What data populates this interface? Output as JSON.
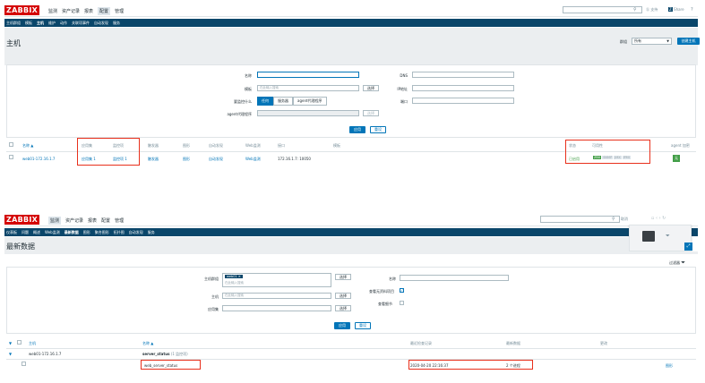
{
  "top": {
    "logo": "ZABBIX",
    "menu": [
      "监测",
      "资产记录",
      "报表",
      "配置",
      "管理"
    ],
    "active_menu": "配置",
    "sub_menu": [
      "主机群组",
      "模板",
      "主机",
      "维护",
      "动作",
      "关联项事件",
      "自动发现",
      "服务"
    ],
    "active_sub": "主机",
    "help_label": "支持",
    "share_label": "Share",
    "question": "?",
    "page_title": "主机",
    "group_label": "群组",
    "group_value": "所有",
    "create_button": "创建主机",
    "filter": {
      "name_label": "名称",
      "dns_label": "DNS",
      "template_label": "模板",
      "template_placeholder": "在此输入搜索",
      "select_label": "选择",
      "ip_label": "IP地址",
      "monitored_by_label": "要监控什么",
      "monitored_options": [
        "任何",
        "服务器",
        "agent代理程序"
      ],
      "port_label": "端口",
      "proxy_label": "agent代理程序",
      "proxy_select": "选择",
      "apply": "应用",
      "reset": "重设"
    },
    "table": {
      "headers": [
        "名称 ▲",
        "应用集",
        "监控项",
        "触发器",
        "图形",
        "自动发现",
        "Web监测",
        "接口",
        "模板",
        "状态",
        "可用性",
        "agent 加密"
      ],
      "row": {
        "name": "web01-172.16.1.7",
        "applications": "应用集 1",
        "items": "监控项 1",
        "triggers": "触发器",
        "graphs": "图形",
        "discovery": "自动发现",
        "web": "Web监测",
        "interface": "172.16.1.7: 10050",
        "status": "已启用",
        "avail": [
          "ZBX",
          "SNMP",
          "JMX",
          "IPMI"
        ],
        "encryption": "无"
      }
    }
  },
  "bottom": {
    "logo": "ZABBIX",
    "menu": [
      "监测",
      "资产记录",
      "报表",
      "配置",
      "管理"
    ],
    "active_menu": "监测",
    "sub_menu": [
      "仪表板",
      "问题",
      "概述",
      "Web监测",
      "最新数据",
      "图形",
      "聚合图形",
      "拓扑图",
      "自动发现",
      "服务"
    ],
    "active_sub": "最新数据",
    "search_text": "取消",
    "page_title": "最新数据",
    "filter_toggle": "过滤器",
    "filter": {
      "host_group_label": "主机群组",
      "host_group_tag": "web01",
      "host_group_placeholder": "在此输入搜索",
      "select_label": "选择",
      "host_label": "主机",
      "host_placeholder": "在此输入搜索",
      "app_label": "应用集",
      "name_label": "名称",
      "show_no_data_label": "查看无资料项目",
      "show_details_label": "查看细节",
      "apply": "应用",
      "reset": "重设"
    },
    "table": {
      "headers": [
        "主机",
        "名称 ▲",
        "最近检查记录",
        "最新数据",
        "更改"
      ],
      "host": "web01-172.16.1.7",
      "app_group": "server_status",
      "app_group_count": "(1 监控项)",
      "item_name": "web_server_status",
      "last_check": "2020-04-20 22:16:37",
      "last_value": "2 个进程",
      "graph_link": "图形"
    }
  }
}
